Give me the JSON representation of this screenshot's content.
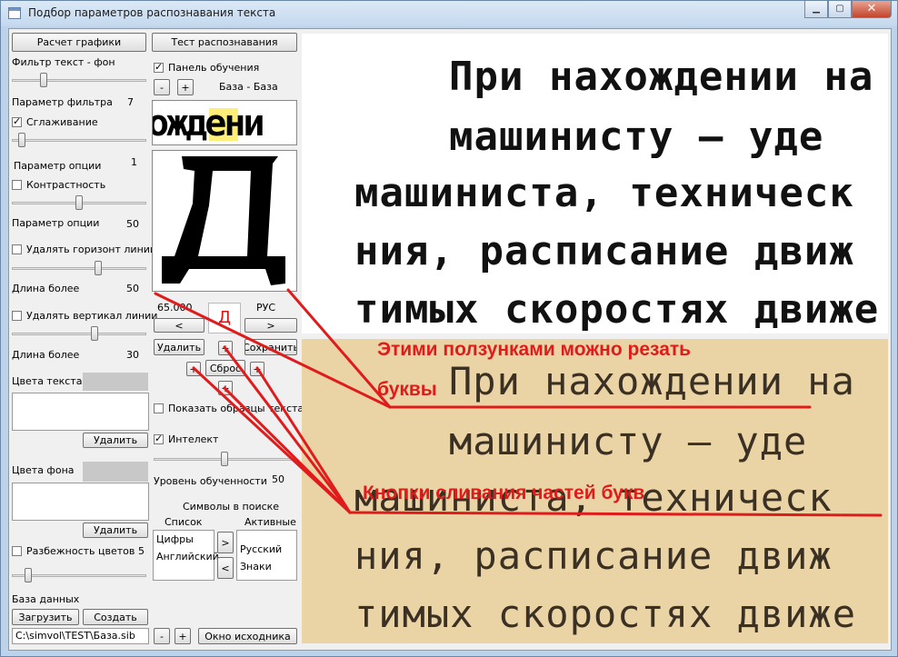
{
  "window": {
    "title": "Подбор параметров распознавания текста",
    "minimize": "▁",
    "maximize": "▢",
    "close": "✕"
  },
  "left": {
    "calc_button": "Расчет графики",
    "filter_label": "Фильтр текст - фон",
    "filter_param_label": "Параметр фильтра",
    "filter_param_value": "7",
    "smoothing": {
      "label": "Сглаживание",
      "checked": true
    },
    "option_param_label": "Параметр опции",
    "option_param_value": "1",
    "contrast": {
      "label": "Контрастность",
      "checked": false
    },
    "option_param2_label": "Параметр опции",
    "option_param2_value": "50",
    "remove_horizontal": {
      "label": "Удалять горизонт линии",
      "checked": false
    },
    "length_label": "Длина более",
    "length_value": "50",
    "remove_vertical": {
      "label": "Удалять вертикал линии",
      "checked": false
    },
    "length2_label": "Длина более",
    "length2_value": "30",
    "text_colors_label": "Цвета текста",
    "delete_text_color": "Удалить",
    "bg_colors_label": "Цвета фона",
    "delete_bg_color": "Удалить",
    "color_spread": {
      "label": "Разбежность цветов",
      "checked": false
    },
    "color_spread_value": "5",
    "database_label": "База данных",
    "load_button": "Загрузить",
    "create_button": "Создать",
    "db_path": "C:\\simvol\\TEST\\База.sib",
    "sliders": {
      "filter": 0.22,
      "smoothing": 0.05,
      "contrast": 0.5,
      "horizontal": 0.65,
      "vertical": 0.62,
      "color_spread": 0.1
    }
  },
  "middle": {
    "test_button": "Тест распознавания",
    "training_panel": {
      "label": "Панель обучения",
      "checked": true
    },
    "minus": "-",
    "plus": "+",
    "base_label": "База - База",
    "strip_text": "ождени",
    "glyph_letter": "Д",
    "glyph_code": "65.000",
    "glyph_lang": "РУС",
    "prev": "<",
    "next": ">",
    "recognized_letter": "Д",
    "delete_button": "Удалить",
    "save_button": "Сохранить",
    "up_plus": "+",
    "plus_left": "+",
    "reset_button": "Сброс",
    "plus_right": "+",
    "plus_bottom": "+",
    "show_samples": {
      "label": "Показать образцы текста",
      "checked": false
    },
    "intellect": {
      "label": "Интелект",
      "checked": true
    },
    "training_level_label": "Уровень обученности",
    "training_level_value": "50",
    "training_slider": 0.5,
    "symbols_label": "Символы в поиске",
    "list_label": "Список",
    "active_label": "Активные",
    "list_items": [
      "Цифры",
      "Английский"
    ],
    "active_items": [
      "Русский",
      "Знаки"
    ],
    "move_right": ">",
    "move_left": "<",
    "bottom_minus": "-",
    "bottom_plus": "+",
    "source_window_button": "Окно исходника"
  },
  "preview": {
    "top_lines": [
      "При нахождении на",
      "машинисту   —   уде",
      "машиниста,  техническ",
      "ния,  расписание  движ",
      "тимых скоростях движе"
    ],
    "bottom_lines": [
      "При нахождении на",
      "машинисту   —   уде",
      "машиниста,  техническ",
      "ния,  расписание  движ",
      "тимых скоростях движе"
    ]
  },
  "annotations": {
    "sliders_note_line1": "Этими ползунками можно резать",
    "sliders_note_line2": "буквы",
    "merge_note": "Кнопки сливания частей букв",
    "color": "#e01b1b"
  }
}
